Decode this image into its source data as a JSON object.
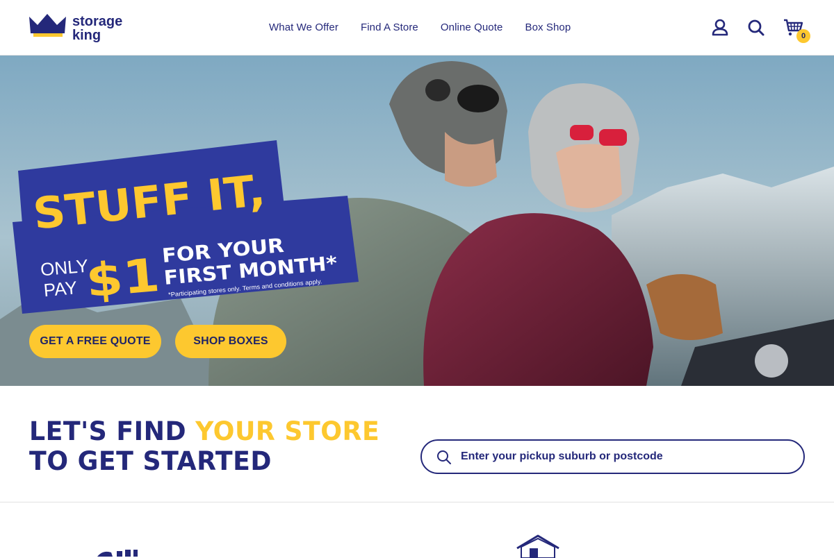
{
  "brand": {
    "name_line1": "storage",
    "name_line2": "king"
  },
  "nav": {
    "items": [
      {
        "label": "What We Offer"
      },
      {
        "label": "Find A Store"
      },
      {
        "label": "Online Quote"
      },
      {
        "label": "Box Shop"
      }
    ]
  },
  "header_icons": {
    "account": "user-icon",
    "search": "search-icon",
    "cart": "cart-icon"
  },
  "cart": {
    "count": "0"
  },
  "hero": {
    "headline": "STUFF IT,",
    "only_pay": [
      "ONLY",
      "PAY"
    ],
    "price": "$1",
    "offer_line1": "FOR YOUR",
    "offer_line2": "FIRST MONTH*",
    "disclaimer": "*Participating stores only. Terms and conditions apply.",
    "buttons": {
      "quote": "GET A FREE QUOTE",
      "shop": "SHOP BOXES"
    }
  },
  "finder": {
    "title_part1": "LET'S FIND ",
    "title_highlight": "YOUR STORE",
    "title_part2": "TO GET STARTED",
    "placeholder": "Enter your pickup suburb or postcode"
  },
  "colors": {
    "brand_navy": "#24287a",
    "brand_yellow": "#fdc82f",
    "promo_blue": "#2f3a9e"
  }
}
